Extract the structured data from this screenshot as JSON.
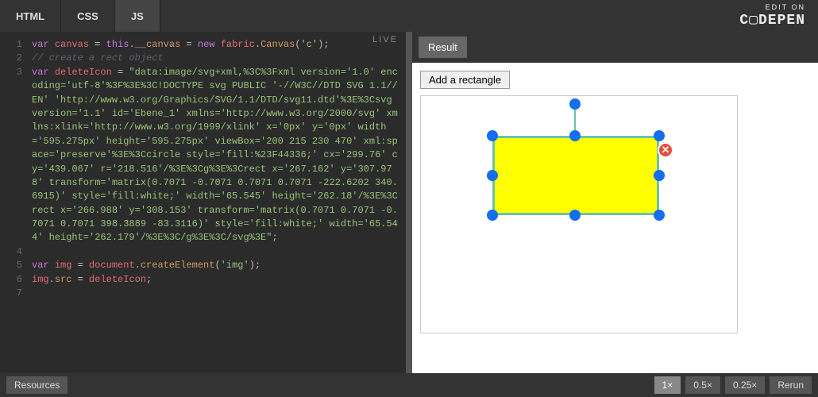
{
  "tabs": {
    "html": "HTML",
    "css": "CSS",
    "js": "JS",
    "active": "js"
  },
  "brand": {
    "editon": "EDIT ON",
    "name": "C▢DEPEN"
  },
  "live_badge": "LIVE",
  "code": {
    "lines": [
      {
        "n": "1",
        "html": "<span class='kw'>var</span> <span class='ident'>canvas</span> <span class='op'>=</span> <span class='kw'>this</span>.<span class='prop'>__canvas</span> <span class='op'>=</span> <span class='kw'>new</span> <span class='ident'>fabric</span>.<span class='prop'>Canvas</span>(<span class='str'>'c'</span>);"
      },
      {
        "n": "2",
        "html": "<span class='cm'>// create a rect object</span>"
      },
      {
        "n": "3",
        "html": "<span class='kw'>var</span> <span class='ident'>deleteIcon</span> <span class='op'>=</span> <span class='str'>\"data:image/svg+xml,%3C%3Fxml version='1.0' encoding='utf-8'%3F%3E%3C!DOCTYPE svg PUBLIC '-//W3C//DTD SVG 1.1//EN' 'http://www.w3.org/Graphics/SVG/1.1/DTD/svg11.dtd'%3E%3Csvg version='1.1' id='Ebene_1' xmlns='http://www.w3.org/2000/svg' xmlns:xlink='http://www.w3.org/1999/xlink' x='0px' y='0px' width='595.275px' height='595.275px' viewBox='200 215 230 470' xml:space='preserve'%3E%3Ccircle style='fill:%23F44336;' cx='299.76' cy='439.067' r='218.516'/%3E%3Cg%3E%3Crect x='267.162' y='307.978' transform='matrix(0.7071 -0.7071 0.7071 0.7071 -222.6202 340.6915)' style='fill:white;' width='65.545' height='262.18'/%3E%3Crect x='266.988' y='308.153' transform='matrix(0.7071 0.7071 -0.7071 0.7071 398.3889 -83.3116)' style='fill:white;' width='65.544' height='262.179'/%3E%3C/g%3E%3C/svg%3E\"</span>;"
      },
      {
        "n": "4",
        "html": ""
      },
      {
        "n": "5",
        "html": "<span class='kw'>var</span> <span class='ident'>img</span> <span class='op'>=</span> <span class='ident'>document</span>.<span class='prop'>createElement</span>(<span class='str'>'img'</span>);"
      },
      {
        "n": "6",
        "html": "<span class='ident'>img</span>.<span class='prop'>src</span> <span class='op'>=</span> <span class='ident'>deleteIcon</span>;"
      },
      {
        "n": "7",
        "html": ""
      }
    ]
  },
  "result": {
    "tab_label": "Result",
    "add_button": "Add a rectangle",
    "rect": {
      "fill": "#ffff00",
      "stroke": "#6ec1a8",
      "handle_fill": "#136ef0"
    },
    "delete_glyph": "✕"
  },
  "bottombar": {
    "resources": "Resources",
    "zoom": {
      "options": [
        "1×",
        "0.5×",
        "0.25×"
      ],
      "active": "1×"
    },
    "rerun": "Rerun"
  }
}
